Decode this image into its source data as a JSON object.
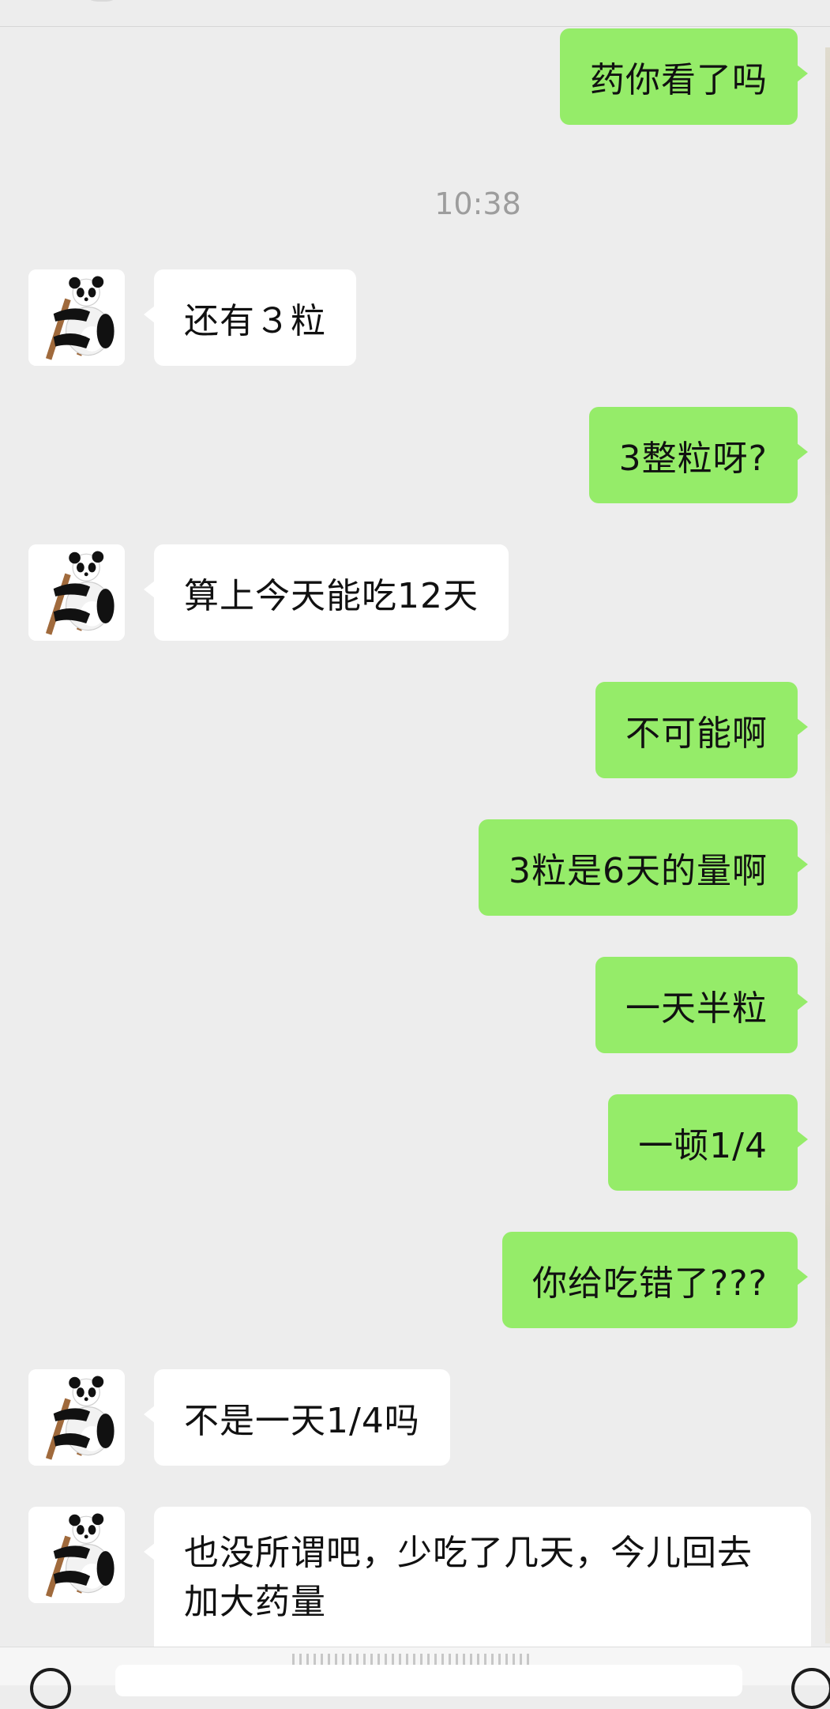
{
  "timestamp": "10:38",
  "messages": [
    {
      "side": "out",
      "text": "药你看了吗"
    },
    {
      "side": "in",
      "text": "还有３粒"
    },
    {
      "side": "out",
      "text": "3整粒呀?"
    },
    {
      "side": "in",
      "text": "算上今天能吃12天"
    },
    {
      "side": "out",
      "text": "不可能啊"
    },
    {
      "side": "out",
      "text": "3粒是6天的量啊"
    },
    {
      "side": "out",
      "text": "一天半粒"
    },
    {
      "side": "out",
      "text": "一顿1/4"
    },
    {
      "side": "out",
      "text": "你给吃错了???"
    },
    {
      "side": "in",
      "text": "不是一天1/4吗"
    },
    {
      "side": "in",
      "text": "也没所谓吧，少吃了几天，今儿回去加大药量"
    }
  ],
  "icons": {
    "contact_avatar": "panda-avatar-icon",
    "voice_button": "voice-icon",
    "emoji_button": "emoji-icon"
  },
  "colors": {
    "background": "#ededed",
    "outgoing_bubble": "#95ec69",
    "incoming_bubble": "#ffffff",
    "timestamp": "#9d9d9d"
  }
}
